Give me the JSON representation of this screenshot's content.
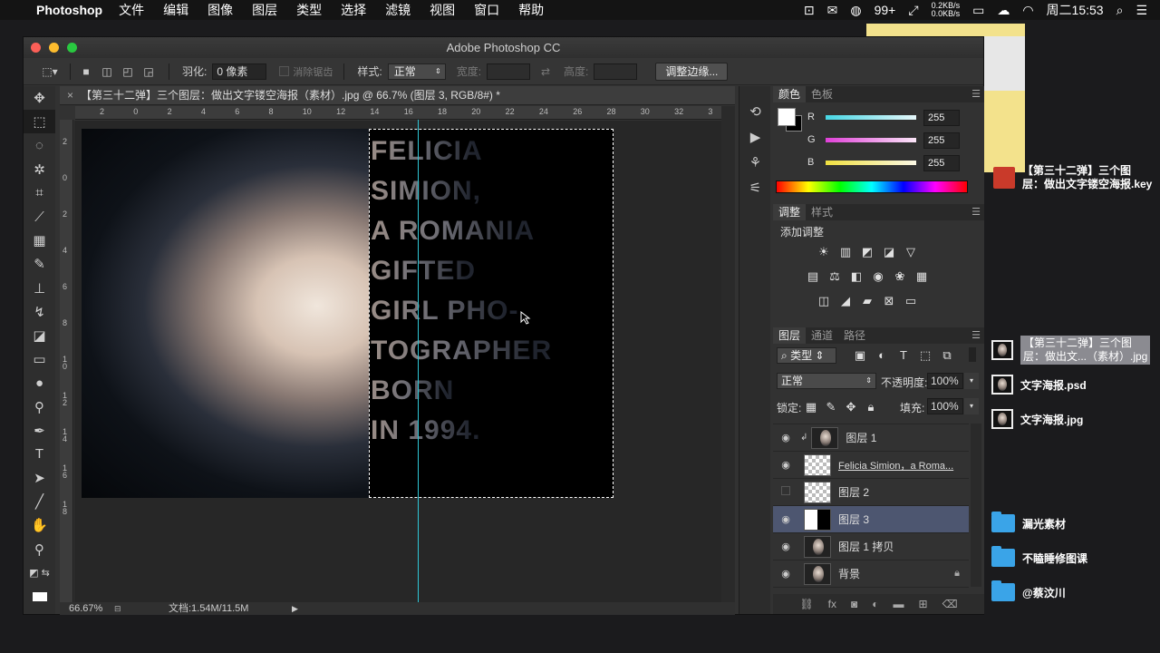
{
  "menubar": {
    "app": "Photoshop",
    "items": [
      "文件",
      "编辑",
      "图像",
      "图层",
      "类型",
      "选择",
      "滤镜",
      "视图",
      "窗口",
      "帮助"
    ],
    "notif_count": "99+",
    "net_up": "0.2KB/s",
    "net_down": "0.0KB/s",
    "clock": "周二15:53"
  },
  "window": {
    "title": "Adobe Photoshop CC"
  },
  "options": {
    "feather_label": "羽化:",
    "feather_value": "0 像素",
    "antialias_label": "消除锯齿",
    "style_label": "样式:",
    "style_value": "正常",
    "width_label": "宽度:",
    "height_label": "高度:",
    "refine_button": "调整边缘..."
  },
  "document": {
    "tab_title": "【第三十二弹】三个图层：做出文字镂空海报（素材）.jpg @ 66.7% (图层 3, RGB/8#) *",
    "ruler_h": [
      "2",
      "0",
      "2",
      "4",
      "6",
      "8",
      "10",
      "12",
      "14",
      "16",
      "18",
      "20",
      "22",
      "24",
      "26",
      "28",
      "30",
      "32",
      "3"
    ],
    "ruler_v": [
      "2",
      "0",
      "2",
      "4",
      "6",
      "8",
      "1 0",
      "1 2",
      "1 4",
      "1 6",
      "1 8"
    ],
    "zoom": "66.67%",
    "doc_size": "文档:1.54M/11.5M",
    "poster_lines": [
      "FELICIA",
      "SIMION,",
      "A ROMANIA",
      "GIFTED",
      "GIRL PHO-",
      "TOGRAPHER",
      "BORN",
      "IN 1994."
    ]
  },
  "color_panel": {
    "tabs": [
      "颜色",
      "色板"
    ],
    "channels": [
      {
        "label": "R",
        "value": "255",
        "color": "#3ad0e0"
      },
      {
        "label": "G",
        "value": "255",
        "color": "#e040d8"
      },
      {
        "label": "B",
        "value": "255",
        "color": "#f0e040"
      }
    ]
  },
  "adjust_panel": {
    "tabs": [
      "调整",
      "样式"
    ],
    "heading": "添加调整"
  },
  "layers_panel": {
    "tabs": [
      "图层",
      "通道",
      "路径"
    ],
    "filter_label": "类型",
    "blend_mode": "正常",
    "opacity_label": "不透明度:",
    "opacity_value": "100%",
    "lock_label": "锁定:",
    "fill_label": "填充:",
    "fill_value": "100%",
    "layers": [
      {
        "name": "图层 1",
        "visible": true,
        "thumb": "face",
        "clipped": true
      },
      {
        "name": "Felicia Simion，a Roma...",
        "visible": true,
        "thumb": "check"
      },
      {
        "name": "图层 2",
        "visible": false,
        "thumb": "check"
      },
      {
        "name": "图层 3",
        "visible": true,
        "thumb": "half",
        "selected": true
      },
      {
        "name": "图层 1 拷贝",
        "visible": true,
        "thumb": "face"
      },
      {
        "name": "背景",
        "visible": true,
        "thumb": "face",
        "locked": true
      }
    ]
  },
  "desktop": {
    "key_file": "【第三十二弹】三个图层：做出文字镂空海报.key",
    "key_file_line1": "【第三十二弹】三个图",
    "key_file_line2": "层：做出文字镂空海报.key",
    "jpg_selected_line1": "【第三十二弹】三个图",
    "jpg_selected_line2": "层：做出文...（素材）.jpg",
    "psd": "文字海报.psd",
    "jpg": "文字海报.jpg",
    "folders": [
      "漏光素材",
      "不瞌睡修图课",
      "@蔡汶川"
    ]
  }
}
